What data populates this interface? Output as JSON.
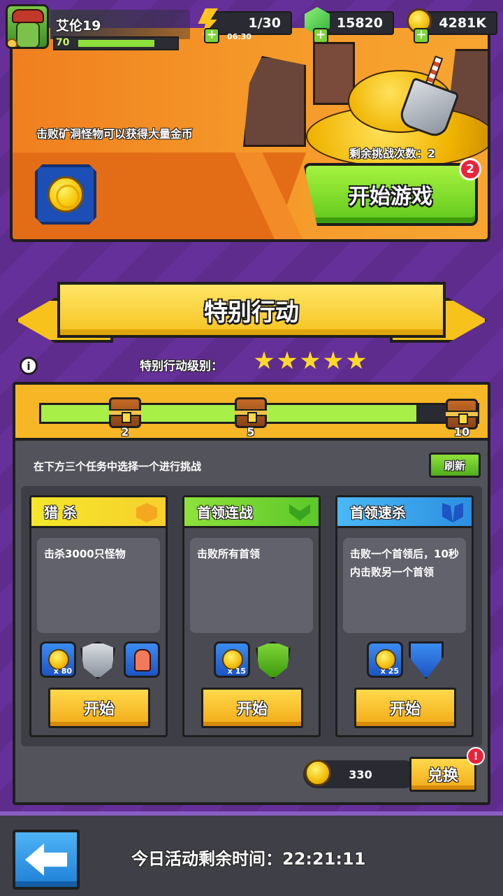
{
  "player": {
    "name": "艾伦19",
    "level": "70",
    "xp_fraction": 0.78
  },
  "resources": {
    "energy": "1/30",
    "energy_timer": "06:30",
    "gems": "15820",
    "gold": "4281K"
  },
  "mine_banner": {
    "description": "击败矿洞怪物可以获得大量金币",
    "remaining": "剩余挑战次数：2",
    "start_label": "开始游戏",
    "badge": "2"
  },
  "special": {
    "title": "特别行动",
    "level_label": "特别行动级别：",
    "stars": 5,
    "info": "i"
  },
  "progress": {
    "fill_fraction": 0.86,
    "milestones": [
      "2",
      "5",
      "10"
    ]
  },
  "tasks": {
    "prompt": "在下方三个任务中选择一个进行挑战",
    "refresh_label": "刷新",
    "cards": [
      {
        "title": "猎 杀",
        "desc": "击杀3000只怪物",
        "count": "x 80",
        "start": "开始"
      },
      {
        "title": "首领连战",
        "desc": "击败所有首领",
        "count": "x 15",
        "start": "开始"
      },
      {
        "title": "首领速杀",
        "desc": "击败一个首领后，10秒内击败另一个首领",
        "count": "x 25",
        "start": "开始"
      }
    ]
  },
  "exchange": {
    "amount": "330",
    "label": "兑换",
    "alert": "!"
  },
  "footer": {
    "time_label": "今日活动剩余时间：22:21:11"
  },
  "colors": {
    "accent_orange": "#f59a2a",
    "green_button": "#60c81b",
    "yellow_button": "#f2aa17",
    "panel_gray": "#53535c"
  }
}
